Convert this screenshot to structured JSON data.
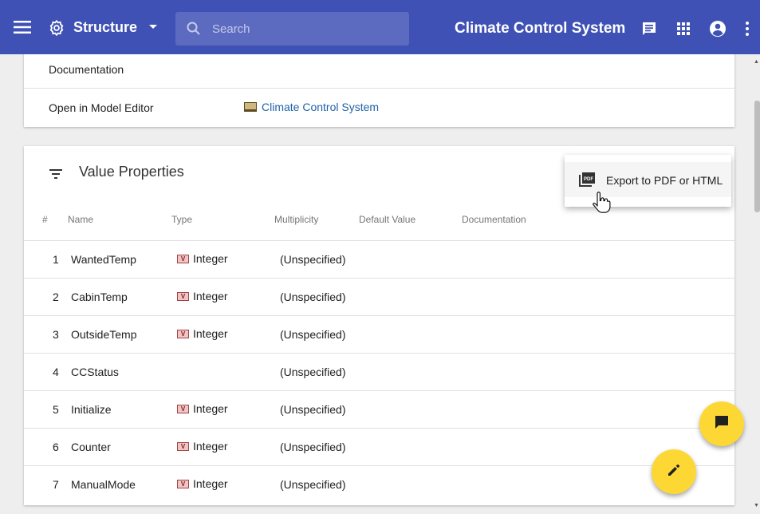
{
  "topbar": {
    "structure_label": "Structure",
    "search_placeholder": "Search",
    "app_title": "Climate Control System"
  },
  "properties": {
    "documentation_label": "Documentation",
    "open_label": "Open in Model Editor",
    "open_link": "Climate Control System"
  },
  "value_properties": {
    "title": "Value Properties",
    "headers": [
      "#",
      "Name",
      "Type",
      "Multiplicity",
      "Default Value",
      "Documentation"
    ],
    "rows": [
      {
        "num": "1",
        "name": "WantedTemp",
        "type": "Integer",
        "multiplicity": "(Unspecified)"
      },
      {
        "num": "2",
        "name": "CabinTemp",
        "type": "Integer",
        "multiplicity": "(Unspecified)"
      },
      {
        "num": "3",
        "name": "OutsideTemp",
        "type": "Integer",
        "multiplicity": "(Unspecified)"
      },
      {
        "num": "4",
        "name": "CCStatus",
        "type": "",
        "multiplicity": "(Unspecified)"
      },
      {
        "num": "5",
        "name": "Initialize",
        "type": "Integer",
        "multiplicity": "(Unspecified)"
      },
      {
        "num": "6",
        "name": "Counter",
        "type": "Integer",
        "multiplicity": "(Unspecified)"
      },
      {
        "num": "7",
        "name": "ManualMode",
        "type": "Integer",
        "multiplicity": "(Unspecified)"
      }
    ]
  },
  "export_menu": {
    "item_label": "Export to PDF or HTML"
  },
  "icons": {
    "type_badge": "V",
    "pdf_badge": "PDF"
  },
  "colors": {
    "primary": "#3f51b5",
    "search_bg": "#5c6bc0",
    "fab": "#fdd835",
    "link": "#1e63a8"
  }
}
